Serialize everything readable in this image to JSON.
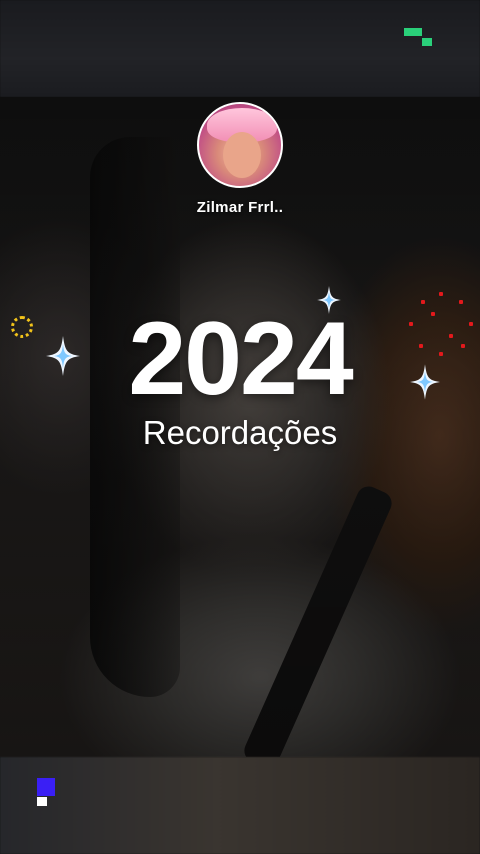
{
  "profile": {
    "username": "Zilmar  Frrl..",
    "avatar_icon": "profile-photo-avatar"
  },
  "recap": {
    "year": "2024",
    "subtitle": "Recordações"
  },
  "decorations": {
    "sparkle_icon": "four-point-sparkle",
    "firework_yellow_color": "#f2c31a",
    "firework_red_color": "#e2191c",
    "watermark_top_color": "#2ad07a",
    "watermark_bottom_colors": [
      "#3a1ff5",
      "#ffffff"
    ]
  }
}
